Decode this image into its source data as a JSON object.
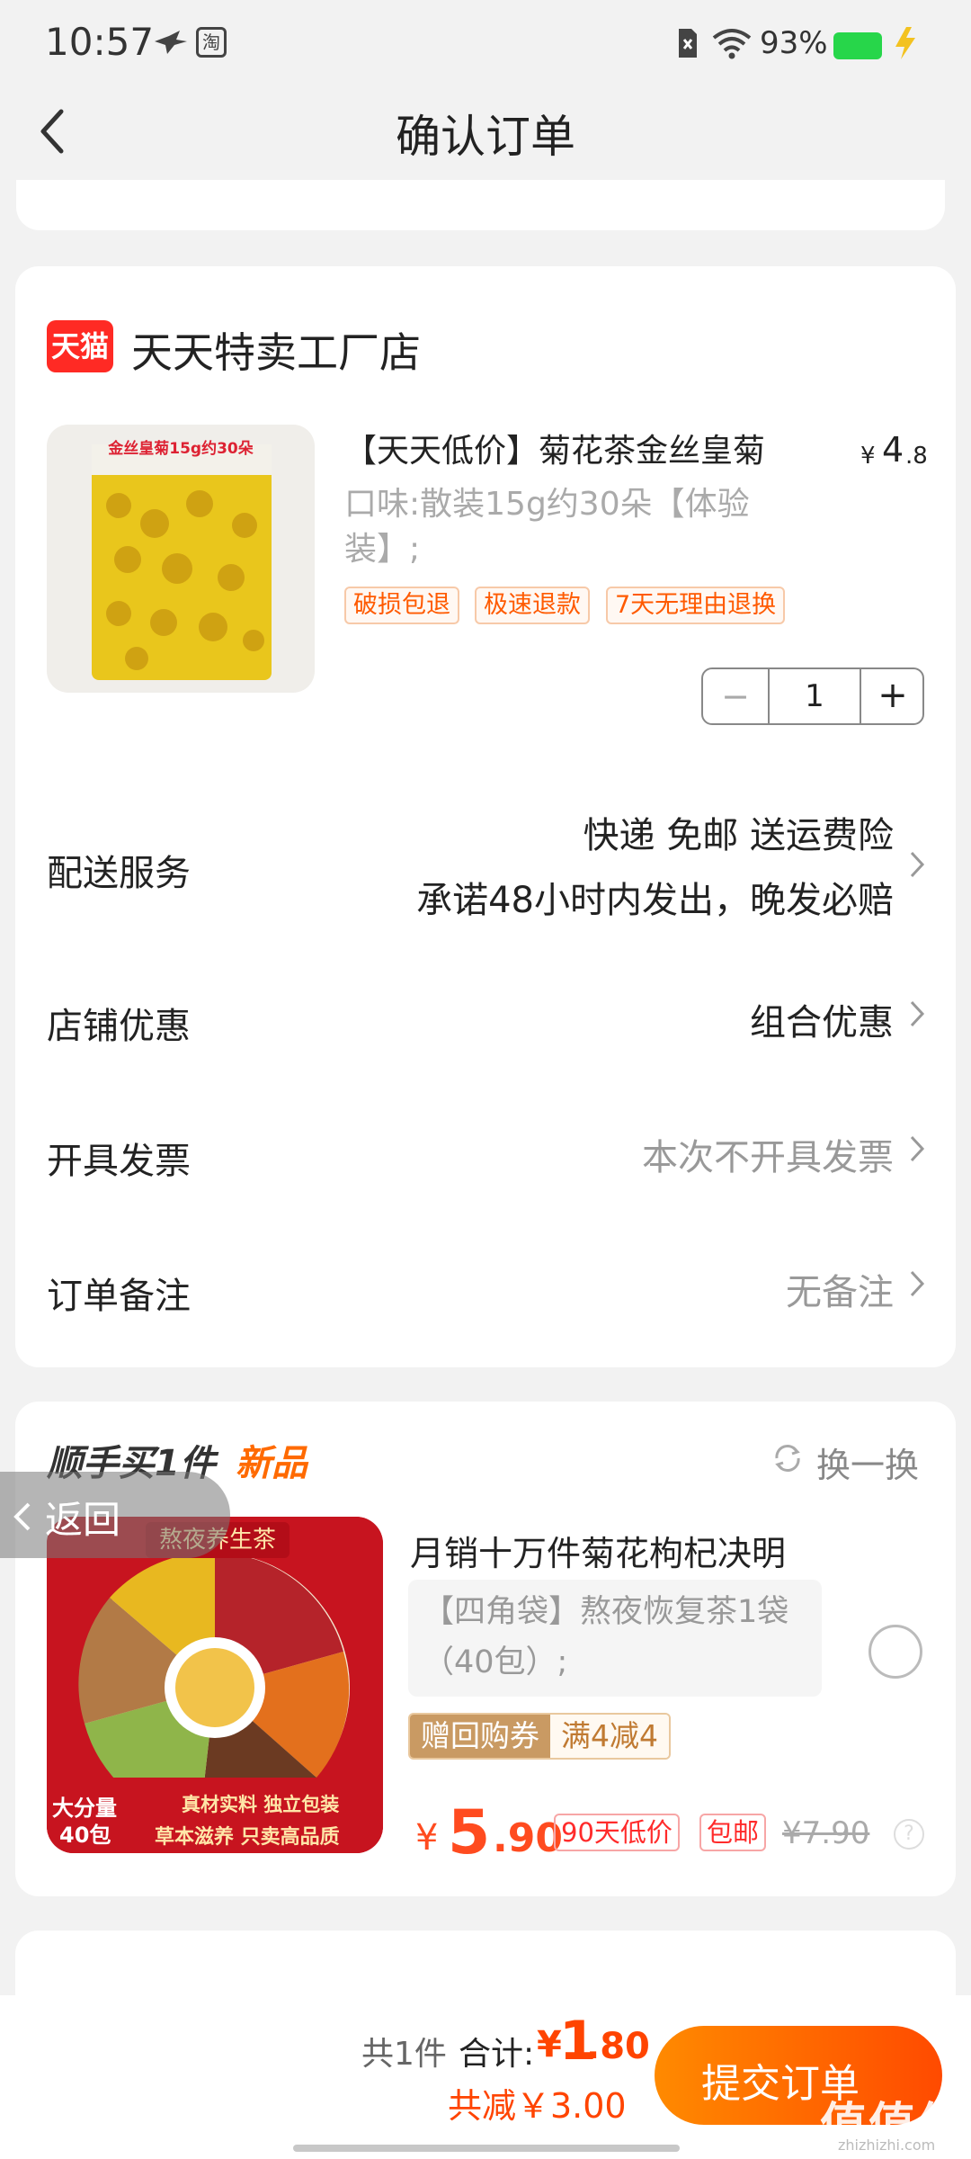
{
  "status_bar": {
    "time": "10:57",
    "battery": "93%",
    "taobao_icon_text": "淘"
  },
  "header": {
    "title": "确认订单"
  },
  "shop": {
    "badge": "天猫",
    "name": "天天特卖工厂店"
  },
  "product": {
    "thumb_label": "金丝皇菊15g约30朵",
    "title": "【天天低价】菊花茶金丝皇菊",
    "price_symbol": "¥",
    "price_int": "4",
    "price_dec": ".8",
    "spec": "口味:散装15g约30朵【体验装】;",
    "tags": [
      "破损包退",
      "极速退款",
      "7天无理由退换"
    ],
    "quantity": "1"
  },
  "rows": {
    "delivery_label": "配送服务",
    "delivery_line1": "快递 免邮 送运费险",
    "delivery_line2": "承诺48小时内发出，晚发必赔",
    "discount_label": "店铺优惠",
    "discount_value": "组合优惠",
    "invoice_label": "开具发票",
    "invoice_value": "本次不开具发票",
    "note_label": "订单备注",
    "note_value": "无备注"
  },
  "upsell": {
    "title": "顺手买1件",
    "new_label": "新品",
    "refresh": "换一换",
    "float_back": "返回",
    "thumb_top": "熬夜养生茶",
    "thumb_badge1": "大分量",
    "thumb_badge2": "40包",
    "thumb_strip1": "真材实料 独立包装",
    "thumb_strip2": "草本滋养 只卖高品质",
    "name": "月销十万件菊花枸杞决明",
    "spec": "【四角袋】熬夜恢复茶1袋（40包）;",
    "coupon_a": "赠回购券",
    "coupon_b": "满4减4",
    "price_symbol": "¥",
    "price_int": "5",
    "price_dec": ".90",
    "tag1": "90天低价",
    "tag2": "包邮",
    "orig_price": "¥7.90",
    "help": "?"
  },
  "bottom": {
    "count": "共1件",
    "total_label": "合计:",
    "total_symbol": "¥",
    "total_int": "1",
    "total_dec": ".80",
    "saved": "共减￥3.00",
    "submit": "提交订单",
    "watermark": "值值值",
    "watermark_url": "zhizhizhi.com"
  }
}
